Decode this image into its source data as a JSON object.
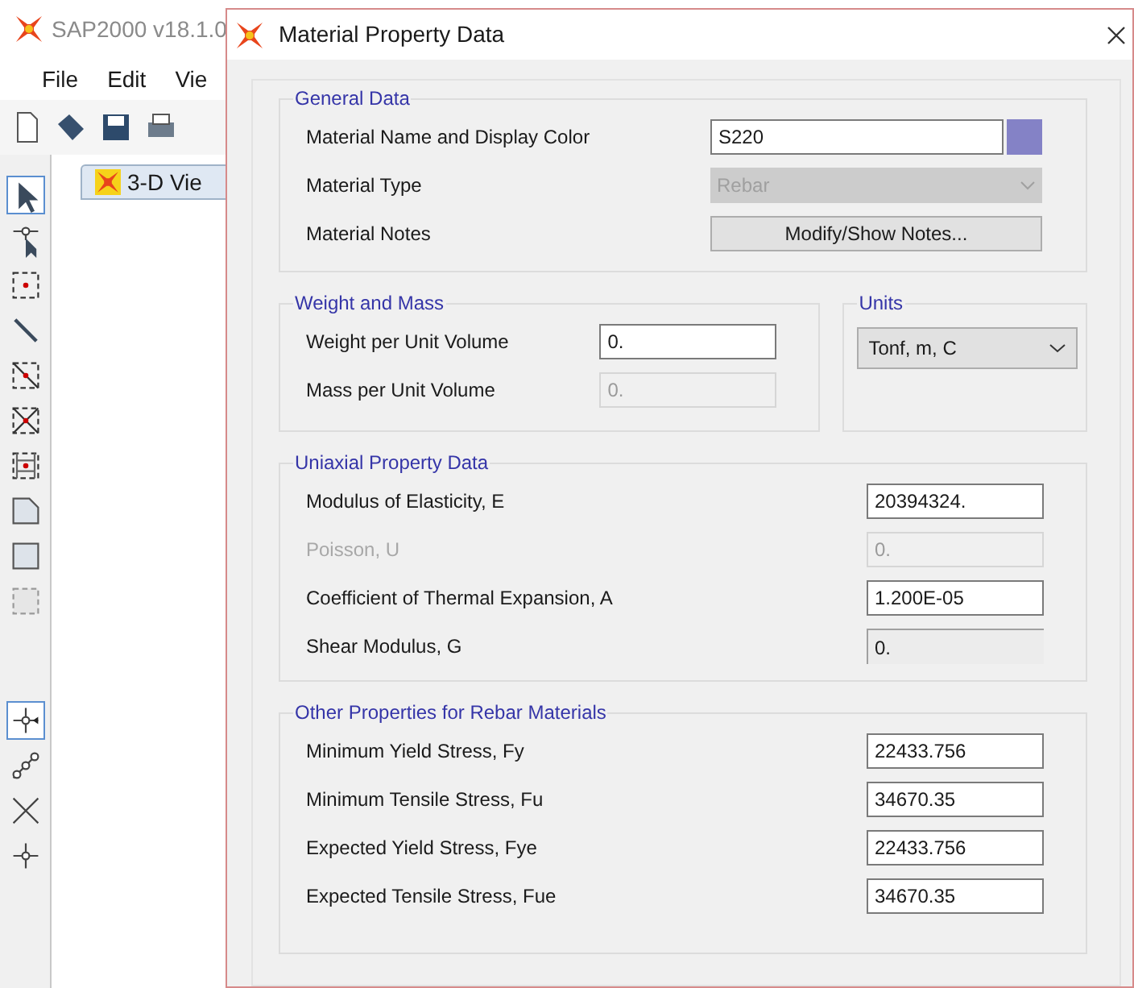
{
  "app": {
    "title": "SAP2000 v18.1.0",
    "menu": [
      "File",
      "Edit",
      "Vie"
    ],
    "view_tab": "3-D Vie"
  },
  "dialog": {
    "title": "Material Property Data",
    "general": {
      "title": "General Data",
      "rows": [
        {
          "label": "Material Name and Display Color",
          "kind": "text",
          "value": "S220",
          "color": "#8482c6",
          "disabled": false
        },
        {
          "label": "Material Type",
          "kind": "dropdown",
          "value": "Rebar",
          "disabled": true
        },
        {
          "label": "Material Notes",
          "kind": "button",
          "value": "Modify/Show Notes...",
          "disabled": false
        }
      ]
    },
    "weight": {
      "title": "Weight and Mass",
      "rows": [
        {
          "label": "Weight per Unit Volume",
          "kind": "text",
          "value": "0.",
          "disabled": false,
          "label_disabled": false
        },
        {
          "label": "Mass per Unit Volume",
          "kind": "text",
          "value": "0.",
          "disabled": true,
          "label_disabled": false
        }
      ]
    },
    "units": {
      "title": "Units",
      "value": "Tonf, m, C"
    },
    "uniaxial": {
      "title": "Uniaxial Property Data",
      "rows": [
        {
          "label": "Modulus of Elasticity,  E",
          "kind": "text",
          "value": "20394324.",
          "disabled": false,
          "label_disabled": false
        },
        {
          "label": "Poisson, U",
          "kind": "text",
          "value": "0.",
          "disabled": true,
          "label_disabled": true
        },
        {
          "label": "Coefficient of Thermal Expansion,  A",
          "kind": "text",
          "value": "1.200E-05",
          "disabled": false,
          "label_disabled": false
        },
        {
          "label": "Shear Modulus,  G",
          "kind": "readonly",
          "value": "0.",
          "disabled": true,
          "label_disabled": false
        }
      ]
    },
    "other": {
      "title": "Other Properties for Rebar Materials",
      "rows": [
        {
          "label": "Minimum Yield Stress, Fy",
          "kind": "text",
          "value": "22433.756",
          "disabled": false,
          "label_disabled": false
        },
        {
          "label": "Minimum Tensile Stress, Fu",
          "kind": "text",
          "value": "34670.35",
          "disabled": false,
          "label_disabled": false
        },
        {
          "label": "Expected Yield Stress, Fye",
          "kind": "text",
          "value": "22433.756",
          "disabled": false,
          "label_disabled": false
        },
        {
          "label": "Expected Tensile Stress, Fue",
          "kind": "text",
          "value": "34670.35",
          "disabled": false,
          "label_disabled": false
        }
      ]
    }
  }
}
